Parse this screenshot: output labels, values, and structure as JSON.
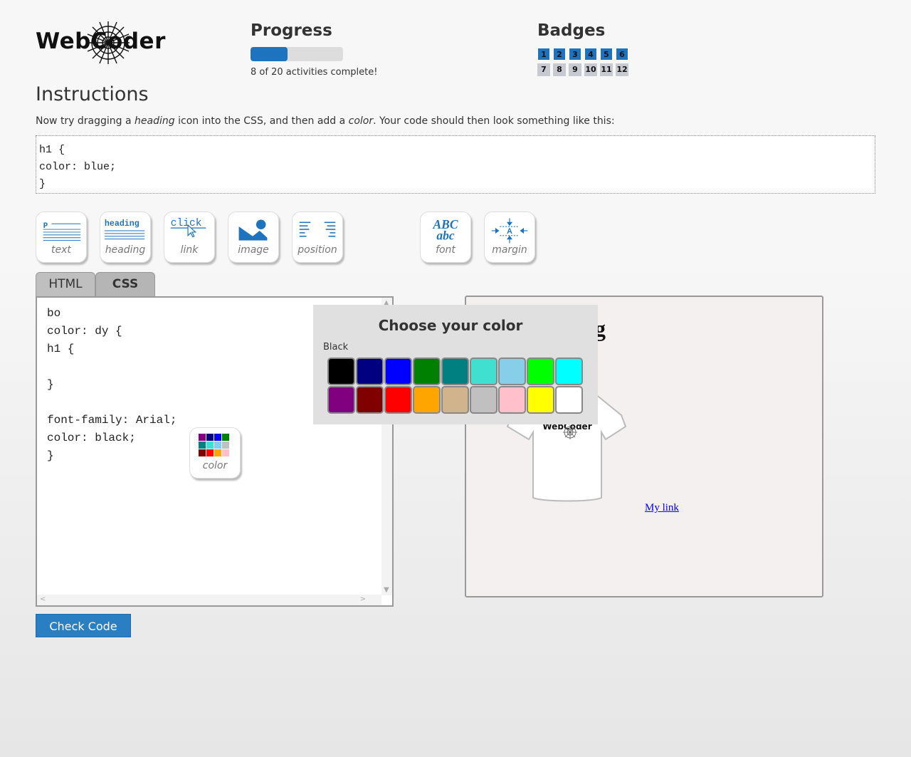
{
  "logo": {
    "text": "WebCoder"
  },
  "progress": {
    "title": "Progress",
    "fraction": 0.4,
    "text": "8 of 20 activities complete!"
  },
  "badges": {
    "title": "Badges",
    "items": [
      {
        "label": "1",
        "earned": true
      },
      {
        "label": "2",
        "earned": true
      },
      {
        "label": "3",
        "earned": true
      },
      {
        "label": "4",
        "earned": true
      },
      {
        "label": "5",
        "earned": true
      },
      {
        "label": "6",
        "earned": true
      },
      {
        "label": "7",
        "earned": false
      },
      {
        "label": "8",
        "earned": false
      },
      {
        "label": "9",
        "earned": false
      },
      {
        "label": "10",
        "earned": false
      },
      {
        "label": "11",
        "earned": false
      },
      {
        "label": "12",
        "earned": false
      }
    ]
  },
  "instructions": {
    "title": "Instructions",
    "text_before": "Now try dragging a ",
    "em1": "heading",
    "text_middle": " icon into the CSS, and then add a ",
    "em2": "color",
    "text_after": ". Your code should then look something like this:",
    "code_lines": [
      "h1 {",
      "color: blue;",
      "}"
    ]
  },
  "toolbar": {
    "tools": [
      {
        "label": "text",
        "icon": "paragraph-icon"
      },
      {
        "label": "heading",
        "icon": "heading-icon"
      },
      {
        "label": "link",
        "icon": "link-icon"
      },
      {
        "label": "image",
        "icon": "image-icon"
      },
      {
        "label": "position",
        "icon": "position-icon"
      },
      {
        "label": "font",
        "icon": "font-icon"
      },
      {
        "label": "margin",
        "icon": "margin-icon"
      }
    ],
    "heading_icon_text": "heading",
    "link_icon_text": "click",
    "font_icon_top": "ABC",
    "font_icon_bottom": "abc",
    "paragraph_icon_text": "P",
    "margin_icon_text": "A"
  },
  "tabs": [
    {
      "label": "HTML",
      "active": false
    },
    {
      "label": "CSS",
      "active": true
    }
  ],
  "editor": {
    "code": "bo\ncolor: dy {\nh1 {\n\n}\n\nfont-family: Arial;\ncolor: black;\n}"
  },
  "color_tool": {
    "label": "color"
  },
  "check_button": {
    "label": "Check Code"
  },
  "preview": {
    "heading_visible": "g",
    "link_text": "My link",
    "shirt_logo": "WebCoder"
  },
  "color_picker": {
    "title": "Choose your color",
    "selected": "Black",
    "colors": [
      "#000000",
      "#000080",
      "#0000ff",
      "#008000",
      "#008080",
      "#40e0d0",
      "#87ceeb",
      "#00ff00",
      "#00ffff",
      "#800080",
      "#800000",
      "#ff0000",
      "#ffa500",
      "#d2b48c",
      "#c0c0c0",
      "#ffc0cb",
      "#ffff00",
      "#ffffff"
    ]
  },
  "colors": {
    "accent": "#1e73be",
    "button": "#2a7ec2"
  }
}
